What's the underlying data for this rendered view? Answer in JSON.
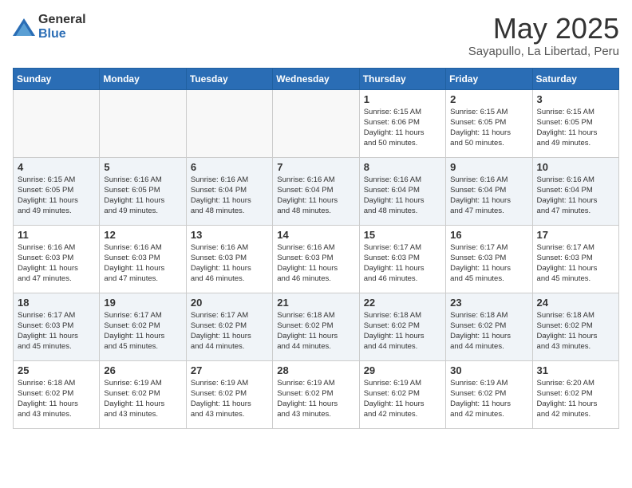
{
  "logo": {
    "general": "General",
    "blue": "Blue"
  },
  "title": "May 2025",
  "subtitle": "Sayapullo, La Libertad, Peru",
  "weekdays": [
    "Sunday",
    "Monday",
    "Tuesday",
    "Wednesday",
    "Thursday",
    "Friday",
    "Saturday"
  ],
  "weeks": [
    [
      {
        "day": "",
        "info": ""
      },
      {
        "day": "",
        "info": ""
      },
      {
        "day": "",
        "info": ""
      },
      {
        "day": "",
        "info": ""
      },
      {
        "day": "1",
        "info": "Sunrise: 6:15 AM\nSunset: 6:06 PM\nDaylight: 11 hours\nand 50 minutes."
      },
      {
        "day": "2",
        "info": "Sunrise: 6:15 AM\nSunset: 6:05 PM\nDaylight: 11 hours\nand 50 minutes."
      },
      {
        "day": "3",
        "info": "Sunrise: 6:15 AM\nSunset: 6:05 PM\nDaylight: 11 hours\nand 49 minutes."
      }
    ],
    [
      {
        "day": "4",
        "info": "Sunrise: 6:15 AM\nSunset: 6:05 PM\nDaylight: 11 hours\nand 49 minutes."
      },
      {
        "day": "5",
        "info": "Sunrise: 6:16 AM\nSunset: 6:05 PM\nDaylight: 11 hours\nand 49 minutes."
      },
      {
        "day": "6",
        "info": "Sunrise: 6:16 AM\nSunset: 6:04 PM\nDaylight: 11 hours\nand 48 minutes."
      },
      {
        "day": "7",
        "info": "Sunrise: 6:16 AM\nSunset: 6:04 PM\nDaylight: 11 hours\nand 48 minutes."
      },
      {
        "day": "8",
        "info": "Sunrise: 6:16 AM\nSunset: 6:04 PM\nDaylight: 11 hours\nand 48 minutes."
      },
      {
        "day": "9",
        "info": "Sunrise: 6:16 AM\nSunset: 6:04 PM\nDaylight: 11 hours\nand 47 minutes."
      },
      {
        "day": "10",
        "info": "Sunrise: 6:16 AM\nSunset: 6:04 PM\nDaylight: 11 hours\nand 47 minutes."
      }
    ],
    [
      {
        "day": "11",
        "info": "Sunrise: 6:16 AM\nSunset: 6:03 PM\nDaylight: 11 hours\nand 47 minutes."
      },
      {
        "day": "12",
        "info": "Sunrise: 6:16 AM\nSunset: 6:03 PM\nDaylight: 11 hours\nand 47 minutes."
      },
      {
        "day": "13",
        "info": "Sunrise: 6:16 AM\nSunset: 6:03 PM\nDaylight: 11 hours\nand 46 minutes."
      },
      {
        "day": "14",
        "info": "Sunrise: 6:16 AM\nSunset: 6:03 PM\nDaylight: 11 hours\nand 46 minutes."
      },
      {
        "day": "15",
        "info": "Sunrise: 6:17 AM\nSunset: 6:03 PM\nDaylight: 11 hours\nand 46 minutes."
      },
      {
        "day": "16",
        "info": "Sunrise: 6:17 AM\nSunset: 6:03 PM\nDaylight: 11 hours\nand 45 minutes."
      },
      {
        "day": "17",
        "info": "Sunrise: 6:17 AM\nSunset: 6:03 PM\nDaylight: 11 hours\nand 45 minutes."
      }
    ],
    [
      {
        "day": "18",
        "info": "Sunrise: 6:17 AM\nSunset: 6:03 PM\nDaylight: 11 hours\nand 45 minutes."
      },
      {
        "day": "19",
        "info": "Sunrise: 6:17 AM\nSunset: 6:02 PM\nDaylight: 11 hours\nand 45 minutes."
      },
      {
        "day": "20",
        "info": "Sunrise: 6:17 AM\nSunset: 6:02 PM\nDaylight: 11 hours\nand 44 minutes."
      },
      {
        "day": "21",
        "info": "Sunrise: 6:18 AM\nSunset: 6:02 PM\nDaylight: 11 hours\nand 44 minutes."
      },
      {
        "day": "22",
        "info": "Sunrise: 6:18 AM\nSunset: 6:02 PM\nDaylight: 11 hours\nand 44 minutes."
      },
      {
        "day": "23",
        "info": "Sunrise: 6:18 AM\nSunset: 6:02 PM\nDaylight: 11 hours\nand 44 minutes."
      },
      {
        "day": "24",
        "info": "Sunrise: 6:18 AM\nSunset: 6:02 PM\nDaylight: 11 hours\nand 43 minutes."
      }
    ],
    [
      {
        "day": "25",
        "info": "Sunrise: 6:18 AM\nSunset: 6:02 PM\nDaylight: 11 hours\nand 43 minutes."
      },
      {
        "day": "26",
        "info": "Sunrise: 6:19 AM\nSunset: 6:02 PM\nDaylight: 11 hours\nand 43 minutes."
      },
      {
        "day": "27",
        "info": "Sunrise: 6:19 AM\nSunset: 6:02 PM\nDaylight: 11 hours\nand 43 minutes."
      },
      {
        "day": "28",
        "info": "Sunrise: 6:19 AM\nSunset: 6:02 PM\nDaylight: 11 hours\nand 43 minutes."
      },
      {
        "day": "29",
        "info": "Sunrise: 6:19 AM\nSunset: 6:02 PM\nDaylight: 11 hours\nand 42 minutes."
      },
      {
        "day": "30",
        "info": "Sunrise: 6:19 AM\nSunset: 6:02 PM\nDaylight: 11 hours\nand 42 minutes."
      },
      {
        "day": "31",
        "info": "Sunrise: 6:20 AM\nSunset: 6:02 PM\nDaylight: 11 hours\nand 42 minutes."
      }
    ]
  ]
}
